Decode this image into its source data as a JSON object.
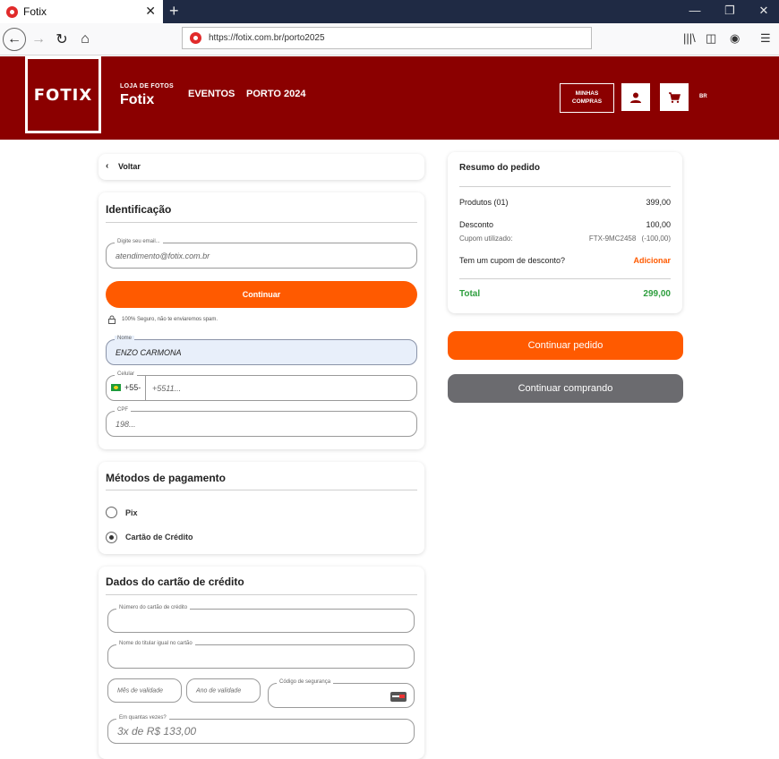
{
  "browser": {
    "tab_title": "Fotix",
    "url": "https://fotix.com.br/porto2025"
  },
  "header": {
    "logo": "FOTIX",
    "store_small": "LOJA DE FOTOS",
    "store_name": "Fotix",
    "menu": [
      "EVENTOS",
      "PORTO 2024"
    ],
    "my_purchases": "MINHAS COMPRAS",
    "lang": "BR"
  },
  "back": "Voltar",
  "identification": {
    "title": "Identificação",
    "email_label": "Digite seu email...",
    "email_value": "atendimento@fotix.com.br",
    "continue_label": "Continuar",
    "secure_note": "100% Seguro, não te enviaremos spam.",
    "name_label": "Nome",
    "name_value": "ENZO CARMONA",
    "phone_label": "Celular",
    "phone_prefix": "+55-",
    "phone_placeholder": "+5511...",
    "cpf_label": "CPF",
    "cpf_placeholder": "198..."
  },
  "payment": {
    "title": "Métodos de pagamento",
    "options": [
      {
        "label": "Pix",
        "selected": false
      },
      {
        "label": "Cartão de Crédito",
        "selected": true
      }
    ]
  },
  "card_data": {
    "title": "Dados do cartão de crédito",
    "number_label": "Número do cartão de crédito",
    "holder_label": "Nome do titular igual no cartão",
    "month_placeholder": "Mês de validade",
    "year_placeholder": "Ano de validade",
    "cvv_label": "Código de segurança",
    "installments_label": "Em quantas vezes?",
    "installments_value": "3x de R$ 133,00"
  },
  "summary": {
    "title": "Resumo do pedido",
    "products_label": "Produtos (01)",
    "products_value": "399,00",
    "discount_label": "Desconto",
    "discount_value": "100,00",
    "coupon_label": "Cupom utilizado:",
    "coupon_value": "FTX-9MC2458",
    "coupon_amount": "(-100,00)",
    "have_coupon": "Tem um cupom de desconto?",
    "add_label": "Adicionar",
    "total_label": "Total",
    "total_value": "299,00",
    "total_color": "#2e9e3e"
  },
  "actions": {
    "continue_order": "Continuar pedido",
    "continue_shopping": "Continuar comprando"
  },
  "colors": {
    "brand": "#8b0000",
    "accent": "#ff5a00",
    "secondary_button": "#6b6b6f"
  }
}
